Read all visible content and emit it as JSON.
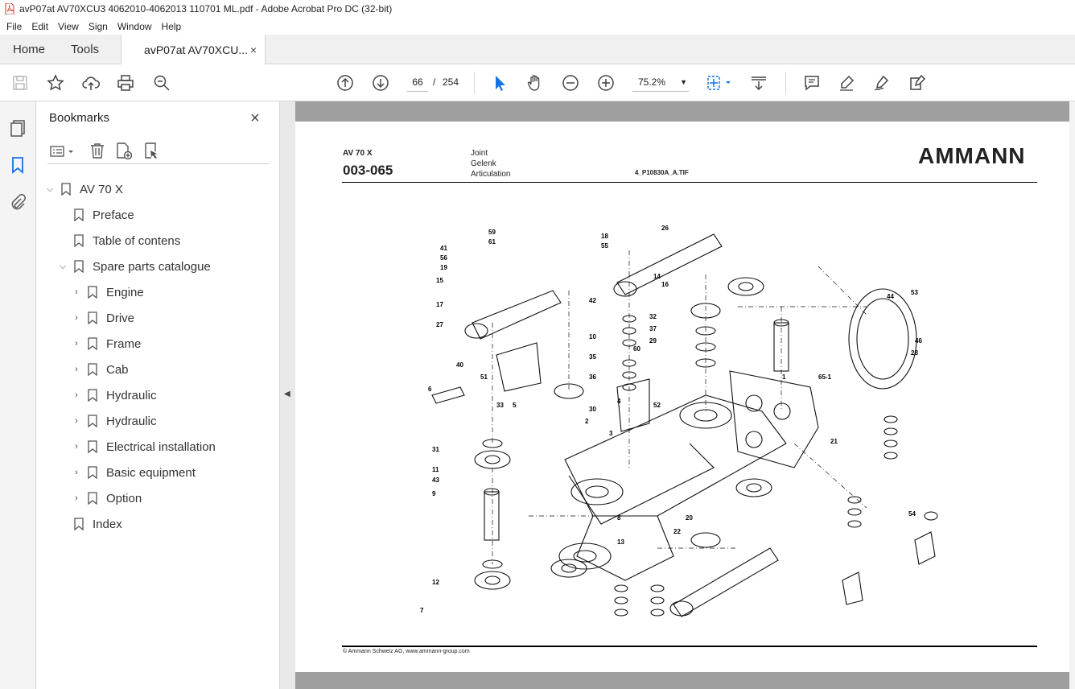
{
  "window": {
    "title": "avP07at AV70XCU3 4062010-4062013 110701 ML.pdf - Adobe Acrobat Pro DC (32-bit)"
  },
  "menu": [
    "File",
    "Edit",
    "View",
    "Sign",
    "Window",
    "Help"
  ],
  "tabs": {
    "home": "Home",
    "tools": "Tools",
    "document": "avP07at AV70XCU...",
    "close": "×"
  },
  "toolbar": {
    "page_current": "66",
    "page_separator": "/",
    "page_total": "254",
    "zoom": "75.2%"
  },
  "bookmarks": {
    "title": "Bookmarks",
    "close": "×",
    "items": [
      {
        "label": "AV 70 X",
        "chevron": "down",
        "level": 0
      },
      {
        "label": "Preface",
        "chevron": "",
        "level": 1
      },
      {
        "label": "Table of contens",
        "chevron": "",
        "level": 1
      },
      {
        "label": "Spare parts catalogue",
        "chevron": "down",
        "level": 1
      },
      {
        "label": "Engine",
        "chevron": "right",
        "level": 2
      },
      {
        "label": "Drive",
        "chevron": "right",
        "level": 2
      },
      {
        "label": "Frame",
        "chevron": "right",
        "level": 2
      },
      {
        "label": "Cab",
        "chevron": "right",
        "level": 2
      },
      {
        "label": "Hydraulic",
        "chevron": "right",
        "level": 2
      },
      {
        "label": "Hydraulic",
        "chevron": "right",
        "level": 2
      },
      {
        "label": "Electrical installation",
        "chevron": "right",
        "level": 2
      },
      {
        "label": "Basic equipment",
        "chevron": "right",
        "level": 2
      },
      {
        "label": "Option",
        "chevron": "right",
        "level": 2
      },
      {
        "label": "Index",
        "chevron": "",
        "level": 1
      }
    ]
  },
  "page": {
    "model": "AV 70 X",
    "code": "003-065",
    "desc_en": "Joint",
    "desc_de": "Gelenk",
    "desc_fr": "Articulation",
    "file": "4_P10830A_A.TIF",
    "logo": "AMMANN",
    "footer": "© Ammann Schweiz AG, www.ammann-group.com",
    "part_labels": [
      "41",
      "56",
      "19",
      "59",
      "61",
      "15",
      "17",
      "27",
      "6",
      "40",
      "51",
      "33",
      "5",
      "31",
      "11",
      "43",
      "9",
      "12",
      "26",
      "14",
      "18",
      "55",
      "16",
      "42",
      "10",
      "35",
      "36",
      "30",
      "2",
      "3",
      "32",
      "37",
      "29",
      "60",
      "44",
      "53",
      "46",
      "28",
      "8",
      "13",
      "22",
      "20",
      "7",
      "54",
      "21",
      "4",
      "52",
      "1",
      "65-1"
    ]
  },
  "colors": {
    "accent": "#1473e6",
    "viewer_bg": "#9f9f9f",
    "pdf_red": "#d32f2f"
  }
}
